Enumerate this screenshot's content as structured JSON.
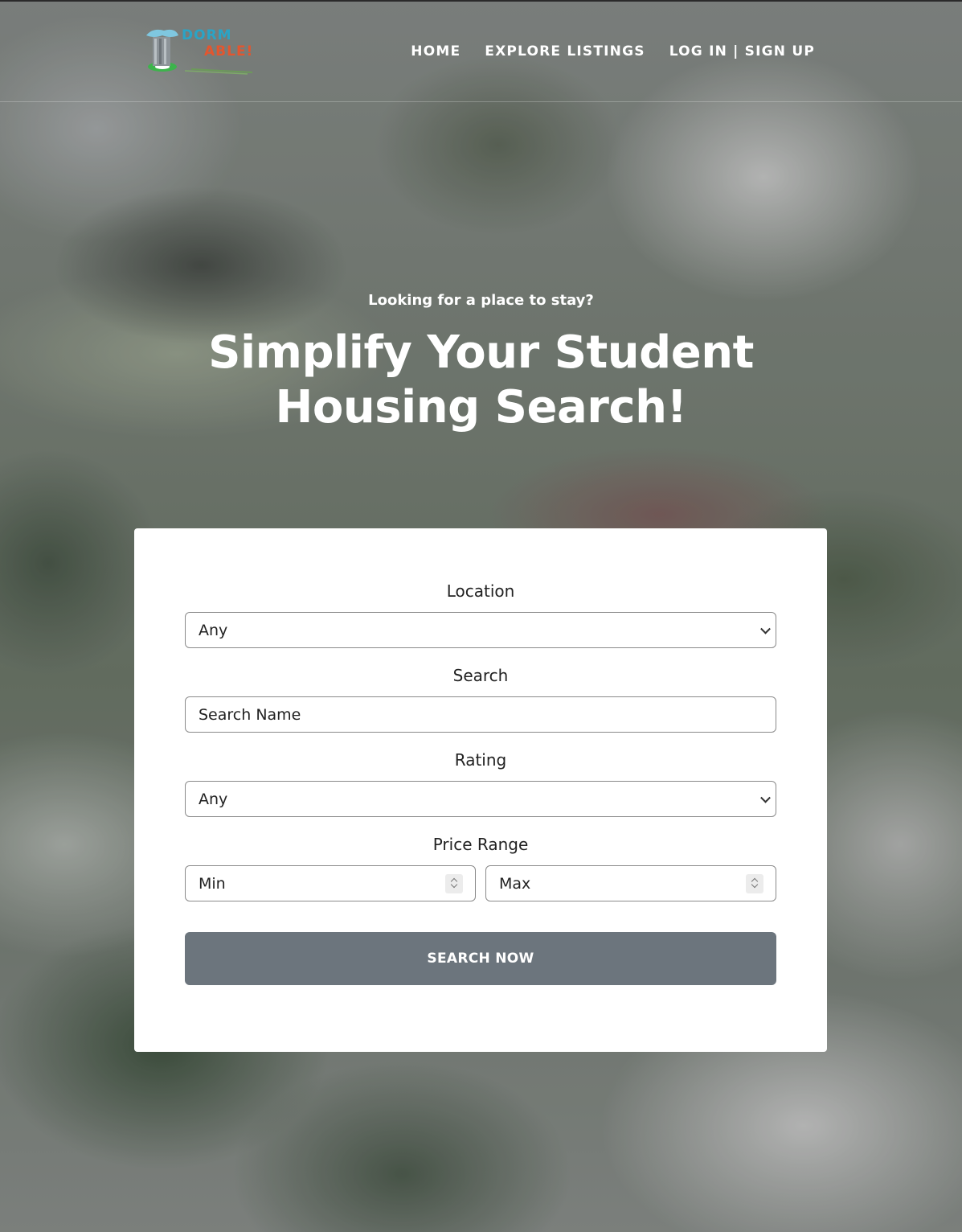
{
  "brand": {
    "logo_text_1": "DORM",
    "logo_text_2": "ABLE!",
    "colors": {
      "accent_blue": "#2aa4c6",
      "accent_orange": "#e2562f",
      "building_green": "#3cb44b",
      "button_gray": "#6c757d"
    }
  },
  "nav": {
    "items": [
      {
        "label": "HOME"
      },
      {
        "label": "EXPLORE LISTINGS"
      },
      {
        "label": "LOG IN | SIGN UP"
      }
    ]
  },
  "hero": {
    "kicker": "Looking for a place to stay?",
    "title_line_1": "Simplify Your Student",
    "title_line_2": "Housing Search!"
  },
  "search_form": {
    "location": {
      "label": "Location",
      "selected": "Any"
    },
    "search": {
      "label": "Search",
      "placeholder": "Search Name"
    },
    "rating": {
      "label": "Rating",
      "selected": "Any"
    },
    "price_range": {
      "label": "Price Range",
      "min_placeholder": "Min",
      "max_placeholder": "Max"
    },
    "submit_label": "SEARCH NOW"
  },
  "icons": [
    "dorm-able-logo-icon",
    "chevron-down-icon",
    "number-spinner-icon"
  ]
}
